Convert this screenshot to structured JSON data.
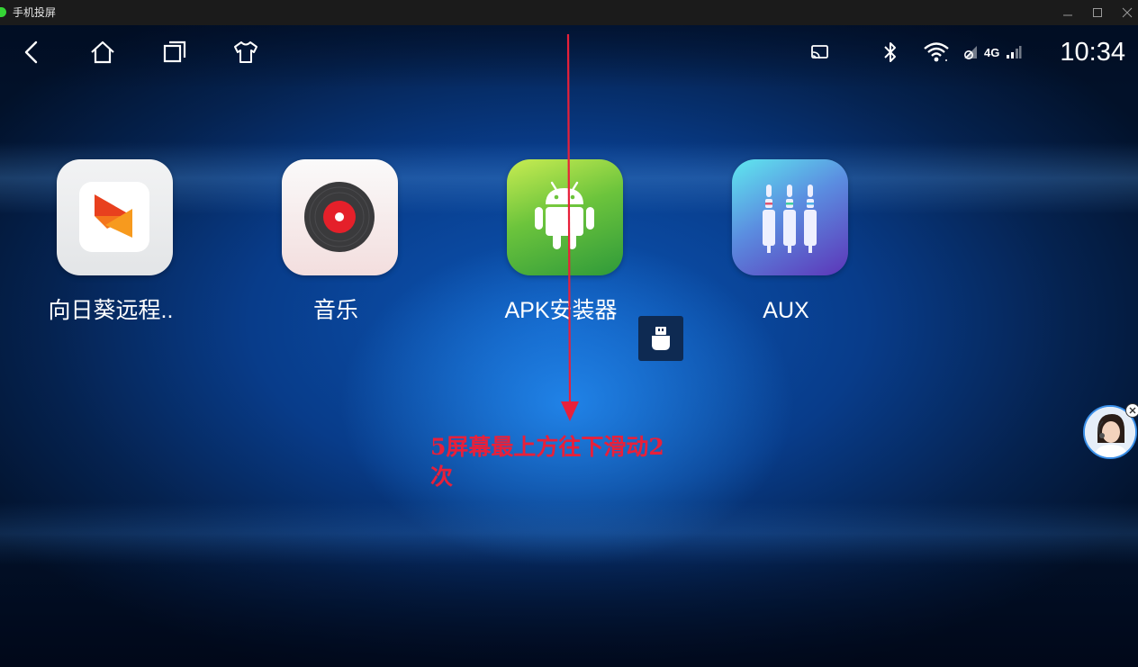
{
  "window": {
    "title": "手机投屏",
    "minimize_icon": "minimize-icon",
    "maximize_icon": "maximize-icon",
    "close_icon": "close-icon"
  },
  "statusbar": {
    "time": "10:34",
    "network": "4G",
    "icons": [
      "back-icon",
      "home-icon",
      "recents-icon",
      "theme-shirt-icon",
      "cast-icon",
      "bluetooth-icon",
      "wifi-icon",
      "signal-icon"
    ]
  },
  "apps": [
    {
      "label": "向日葵远程..",
      "icon": "sunflower-remote-icon"
    },
    {
      "label": "音乐",
      "icon": "music-disc-icon"
    },
    {
      "label": "APK安装器",
      "icon": "android-icon"
    },
    {
      "label": "AUX",
      "icon": "aux-jack-icon"
    }
  ],
  "annotation": {
    "text": "5屏幕最上方往下滑动2次",
    "color": "#e8203a"
  },
  "colors": {
    "accent_blue": "#0c55b5",
    "annotation_red": "#e8203a"
  }
}
